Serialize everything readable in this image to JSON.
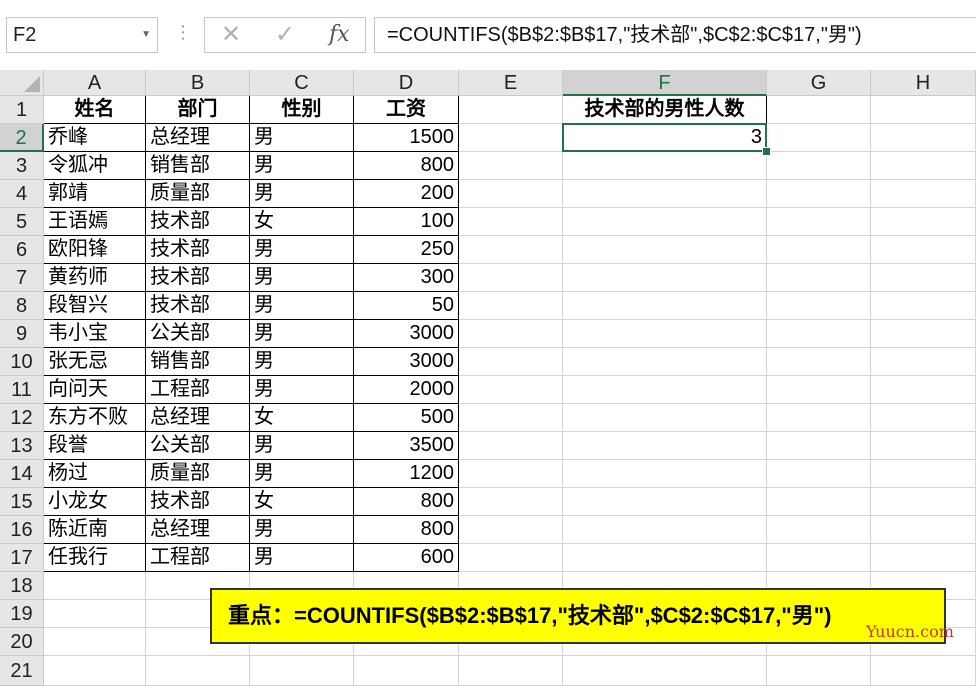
{
  "name_box": "F2",
  "formula": "=COUNTIFS($B$2:$B$17,\"技术部\",$C$2:$C$17,\"男\")",
  "columns": [
    "A",
    "B",
    "C",
    "D",
    "E",
    "F",
    "G",
    "H"
  ],
  "rows": [
    "1",
    "2",
    "3",
    "4",
    "5",
    "6",
    "7",
    "8",
    "9",
    "10",
    "11",
    "12",
    "13",
    "14",
    "15",
    "16",
    "17",
    "18",
    "19",
    "20",
    "21"
  ],
  "table": {
    "headers": [
      "姓名",
      "部门",
      "性别",
      "工资"
    ],
    "records": [
      [
        "乔峰",
        "总经理",
        "男",
        "1500"
      ],
      [
        "令狐冲",
        "销售部",
        "男",
        "800"
      ],
      [
        "郭靖",
        "质量部",
        "男",
        "200"
      ],
      [
        "王语嫣",
        "技术部",
        "女",
        "100"
      ],
      [
        "欧阳锋",
        "技术部",
        "男",
        "250"
      ],
      [
        "黄药师",
        "技术部",
        "男",
        "300"
      ],
      [
        "段智兴",
        "技术部",
        "男",
        "50"
      ],
      [
        "韦小宝",
        "公关部",
        "男",
        "3000"
      ],
      [
        "张无忌",
        "销售部",
        "男",
        "3000"
      ],
      [
        "向问天",
        "工程部",
        "男",
        "2000"
      ],
      [
        "东方不败",
        "总经理",
        "女",
        "500"
      ],
      [
        "段誉",
        "公关部",
        "男",
        "3500"
      ],
      [
        "杨过",
        "质量部",
        "男",
        "1200"
      ],
      [
        "小龙女",
        "技术部",
        "女",
        "800"
      ],
      [
        "陈近南",
        "总经理",
        "男",
        "800"
      ],
      [
        "任我行",
        "工程部",
        "男",
        "600"
      ]
    ]
  },
  "result": {
    "header": "技术部的男性人数",
    "value": "3"
  },
  "note": "重点：=COUNTIFS($B$2:$B$17,\"技术部\",$C$2:$C$17,\"男\")",
  "watermark": "Yuucn.com",
  "accent_color": "#217346",
  "note_bg": "#ffff00"
}
